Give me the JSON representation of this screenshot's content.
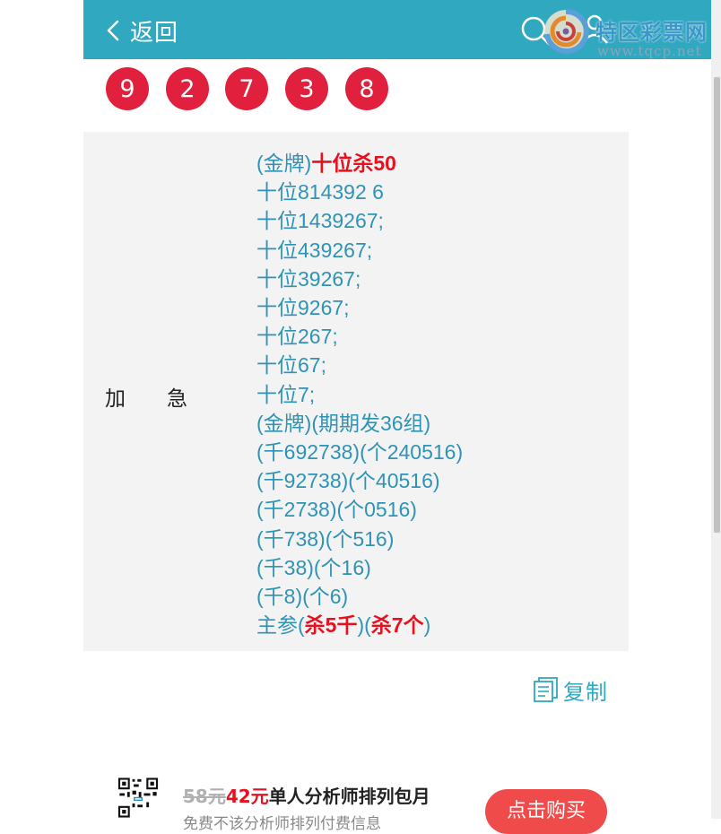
{
  "header": {
    "back_label": "返回",
    "background_color": "#2fa8c0"
  },
  "watermark": {
    "title": "特区彩票网",
    "url": "www.tqcp.net"
  },
  "balls": [
    "9",
    "2",
    "7",
    "3",
    "8"
  ],
  "ball_color": "#e0203c",
  "card": {
    "row_label": "加急",
    "lines": [
      [
        {
          "t": "(金牌)",
          "h": false
        },
        {
          "t": "十位杀50",
          "h": true
        }
      ],
      [
        {
          "t": "十位814392 6",
          "h": false
        }
      ],
      [
        {
          "t": "十位1439267;",
          "h": false
        }
      ],
      [
        {
          "t": "十位439267;",
          "h": false
        }
      ],
      [
        {
          "t": "十位39267;",
          "h": false
        }
      ],
      [
        {
          "t": "十位9267;",
          "h": false
        }
      ],
      [
        {
          "t": "十位267;",
          "h": false
        }
      ],
      [
        {
          "t": "十位67;",
          "h": false
        }
      ],
      [
        {
          "t": "十位7;",
          "h": false
        }
      ],
      [
        {
          "t": "(金牌)(期期发36组)",
          "h": false
        }
      ],
      [
        {
          "t": "(千692738)(个240516)",
          "h": false
        }
      ],
      [
        {
          "t": "(千92738)(个40516)",
          "h": false
        }
      ],
      [
        {
          "t": "(千2738)(个0516)",
          "h": false
        }
      ],
      [
        {
          "t": "(千738)(个516)",
          "h": false
        }
      ],
      [
        {
          "t": "(千38)(个16)",
          "h": false
        }
      ],
      [
        {
          "t": "(千8)(个6)",
          "h": false
        }
      ],
      [
        {
          "t": "主参(",
          "h": false
        },
        {
          "t": "杀5千",
          "h": true
        },
        {
          "t": ")(",
          "h": false
        },
        {
          "t": "杀7个",
          "h": true
        },
        {
          "t": ")",
          "h": false
        }
      ]
    ]
  },
  "copy_label": "复制",
  "ad": {
    "old_price": "58元",
    "new_price": "42元",
    "title": "单人分析师排列包月",
    "subtitle": "免费不该分析师排列付费信息",
    "buy_label": "点击购买"
  }
}
